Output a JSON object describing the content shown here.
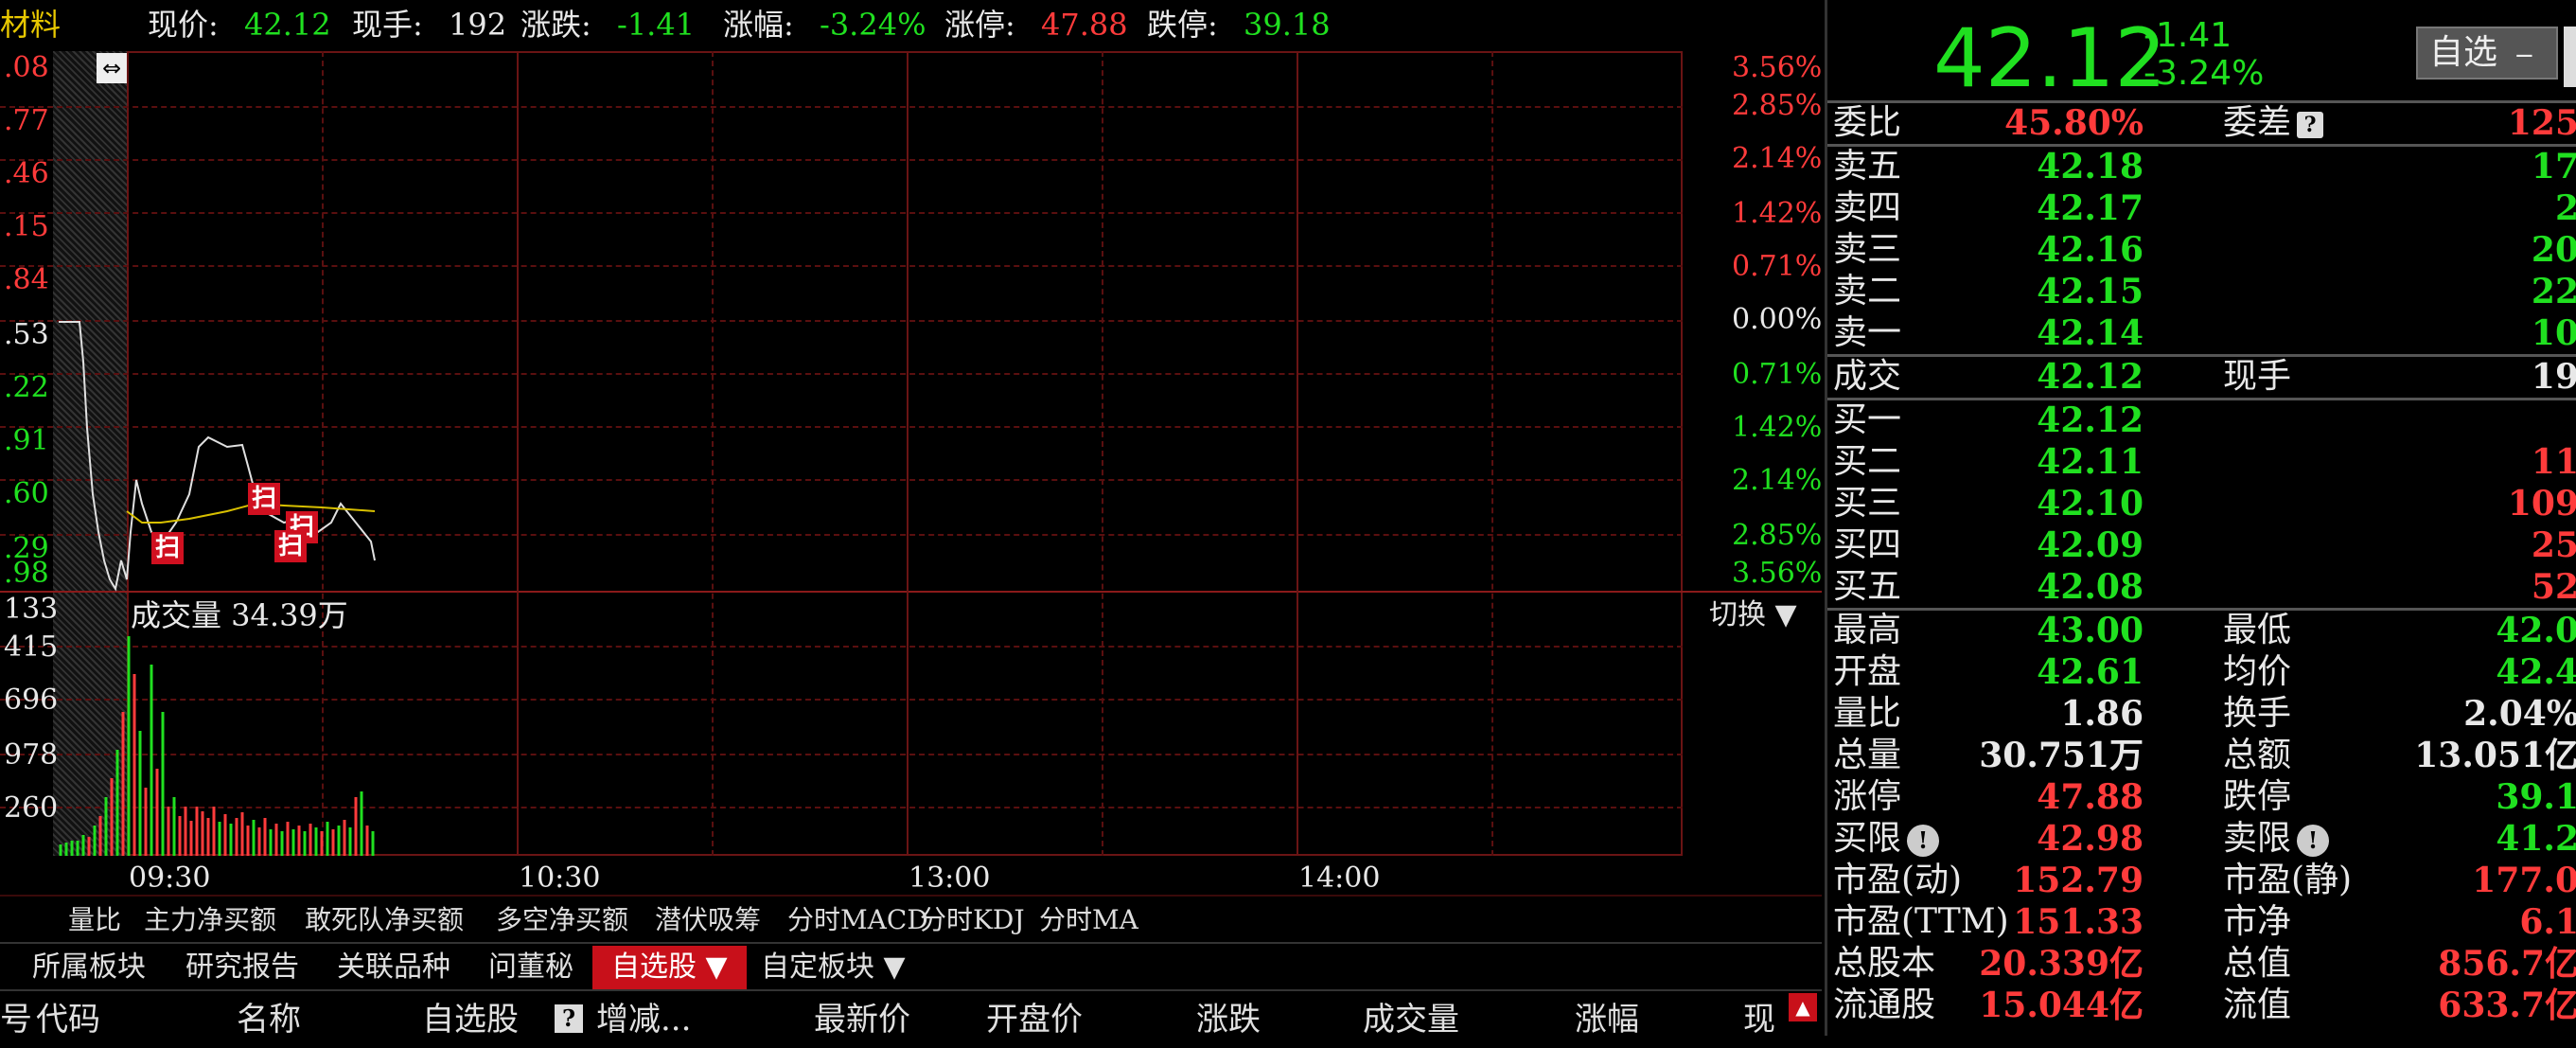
{
  "infobar": {
    "name": "材料",
    "price_label": "现价:",
    "price": "42.12",
    "hand_label": "现手:",
    "hand": "192",
    "change_label": "涨跌:",
    "change": "-1.41",
    "pct_label": "涨幅:",
    "pct": "-3.24%",
    "limit_up_label": "涨停:",
    "limit_up": "47.88",
    "limit_down_label": "跌停:",
    "limit_down": "39.18"
  },
  "chart": {
    "left_price_labels": [
      ".08",
      ".77",
      ".46",
      ".15",
      ".84",
      ".53",
      ".22",
      ".91",
      ".60",
      ".29",
      ".98"
    ],
    "right_pct_labels": [
      "3.56%",
      "2.85%",
      "2.14%",
      "1.42%",
      "0.71%",
      "0.00%",
      "0.71%",
      "1.42%",
      "2.14%",
      "2.85%",
      "3.56%"
    ],
    "volume_title": "成交量 34.39万",
    "volume_labels": [
      "133",
      "415",
      "696",
      "978",
      "260"
    ],
    "switch_label": "切换 ▼",
    "time_labels": [
      "09:30",
      "10:30",
      "13:00",
      "14:00"
    ],
    "scan_marks": [
      "扫",
      "扫",
      "扫",
      "扫"
    ],
    "drag_icon": "⇔"
  },
  "indicators": [
    "量比",
    "主力净买额",
    "敢死队净买额",
    "多空净买额",
    "潜伏吸筹",
    "分时MACD",
    "分时KDJ",
    "分时MA"
  ],
  "tabs": [
    "所属板块",
    "研究报告",
    "关联品种",
    "问董秘",
    "自选股 ▼",
    "自定板块 ▼"
  ],
  "table_headers": [
    "号",
    "代码",
    "名称",
    "自选股",
    "增减...",
    "最新价",
    "开盘价",
    "涨跌",
    "成交量",
    "涨幅",
    "现"
  ],
  "panel": {
    "price": "42.12",
    "change": "-1.41",
    "pct": "-3.24%",
    "watch_button": "自选",
    "ratio": {
      "l1": "委比",
      "v1": "45.80%",
      "l2": "委差",
      "v2": "125"
    },
    "sells": [
      {
        "l": "卖五",
        "p": "42.18",
        "q": "17"
      },
      {
        "l": "卖四",
        "p": "42.17",
        "q": "2"
      },
      {
        "l": "卖三",
        "p": "42.16",
        "q": "20"
      },
      {
        "l": "卖二",
        "p": "42.15",
        "q": "22"
      },
      {
        "l": "卖一",
        "p": "42.14",
        "q": "10"
      }
    ],
    "deal": {
      "l1": "成交",
      "v1": "42.12",
      "l2": "现手",
      "v2": "19"
    },
    "buys": [
      {
        "l": "买一",
        "p": "42.12",
        "q": ""
      },
      {
        "l": "买二",
        "p": "42.11",
        "q": "11"
      },
      {
        "l": "买三",
        "p": "42.10",
        "q": "109"
      },
      {
        "l": "买四",
        "p": "42.09",
        "q": "25"
      },
      {
        "l": "买五",
        "p": "42.08",
        "q": "52"
      }
    ],
    "stats": [
      {
        "l1": "最高",
        "v1": "43.00",
        "c1": "green",
        "l2": "最低",
        "v2": "42.0",
        "c2": "green"
      },
      {
        "l1": "开盘",
        "v1": "42.61",
        "c1": "green",
        "l2": "均价",
        "v2": "42.4",
        "c2": "green"
      },
      {
        "l1": "量比",
        "v1": "1.86",
        "c1": "white",
        "l2": "换手",
        "v2": "2.04%",
        "c2": "white"
      },
      {
        "l1": "总量",
        "v1": "30.751万",
        "c1": "white",
        "l2": "总额",
        "v2": "13.051亿",
        "c2": "white"
      },
      {
        "l1": "涨停",
        "v1": "47.88",
        "c1": "red",
        "l2": "跌停",
        "v2": "39.1",
        "c2": "green"
      },
      {
        "l1": "买限",
        "v1": "42.98",
        "c1": "red",
        "l2": "卖限",
        "v2": "41.2",
        "c2": "green",
        "icon": true
      },
      {
        "l1": "市盈(动)",
        "v1": "152.79",
        "c1": "red",
        "l2": "市盈(静)",
        "v2": "177.0",
        "c2": "red"
      },
      {
        "l1": "市盈(TTM)",
        "v1": "151.33",
        "c1": "red",
        "l2": "市净",
        "v2": "6.1",
        "c2": "red"
      },
      {
        "l1": "总股本",
        "v1": "20.339亿",
        "c1": "red",
        "l2": "总值",
        "v2": "856.7亿",
        "c2": "red"
      },
      {
        "l1": "流通股",
        "v1": "15.044亿",
        "c1": "red",
        "l2": "流值",
        "v2": "633.7亿",
        "c2": "red"
      }
    ]
  }
}
